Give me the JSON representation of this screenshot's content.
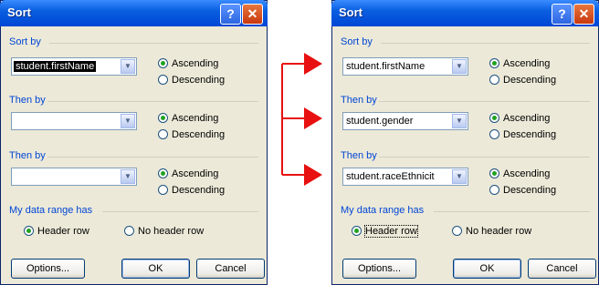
{
  "colors": {
    "title_bar": "#0a5fe0",
    "section_label": "#0046d5",
    "arrow": "#e81010"
  },
  "left_dialog": {
    "title": "Sort",
    "help_label": "?",
    "close_label": "✕",
    "sort_by_label": "Sort by",
    "sort_by_value": "student.firstName",
    "then_by_1_label": "Then by",
    "then_by_1_value": "",
    "then_by_2_label": "Then by",
    "then_by_2_value": "",
    "ascending": "Ascending",
    "descending": "Descending",
    "range_label": "My data range has",
    "header_row": "Header row",
    "no_header_row": "No header row",
    "options": "Options...",
    "ok": "OK",
    "cancel": "Cancel"
  },
  "right_dialog": {
    "title": "Sort",
    "help_label": "?",
    "close_label": "✕",
    "sort_by_label": "Sort by",
    "sort_by_value": "student.firstName",
    "then_by_1_label": "Then by",
    "then_by_1_value": "student.gender",
    "then_by_2_label": "Then by",
    "then_by_2_value": "student.raceEthnicit",
    "ascending": "Ascending",
    "descending": "Descending",
    "range_label": "My data range has",
    "header_row": "Header row",
    "no_header_row": "No header row",
    "options": "Options...",
    "ok": "OK",
    "cancel": "Cancel"
  }
}
